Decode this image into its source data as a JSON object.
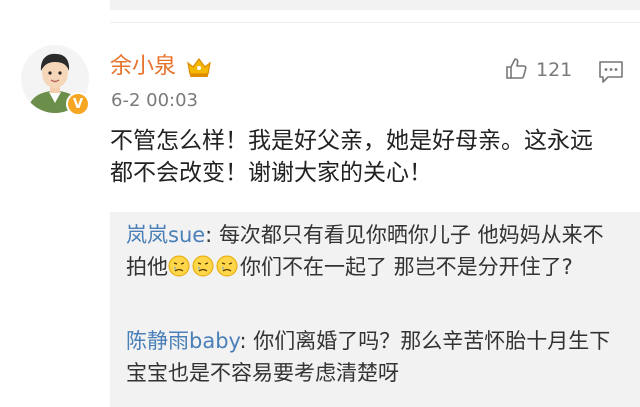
{
  "comment": {
    "username": "余小泉",
    "timestamp": "6-2 00:03",
    "like_count": "121",
    "text": "不管怎么样！我是好父亲，她是好母亲。这永远都不会改变！谢谢大家的关心！"
  },
  "replies": [
    {
      "username": "岚岚sue",
      "separator": ": ",
      "text_before_emoji": "每次都只有看见你晒你儿子 他妈妈从来不拍他",
      "emoji_names": [
        "sad-face-icon",
        "sad-face-icon",
        "sad-face-icon"
      ],
      "text_after_emoji": "你们不在一起了 那岂不是分开住了?"
    },
    {
      "username": "陈静雨baby",
      "separator": ": ",
      "text": "你们离婚了吗？那么辛苦怀胎十月生下宝宝也是不容易要考虑清楚呀"
    }
  ],
  "icons": {
    "badge": "V",
    "vip": "crown-icon",
    "like": "thumbs-up-icon",
    "comment": "comment-icon"
  },
  "colors": {
    "username": "#e8722c",
    "reply_username": "#4a7fb8",
    "reply_background": "#f2f2f2",
    "badge": "#f6a623"
  }
}
